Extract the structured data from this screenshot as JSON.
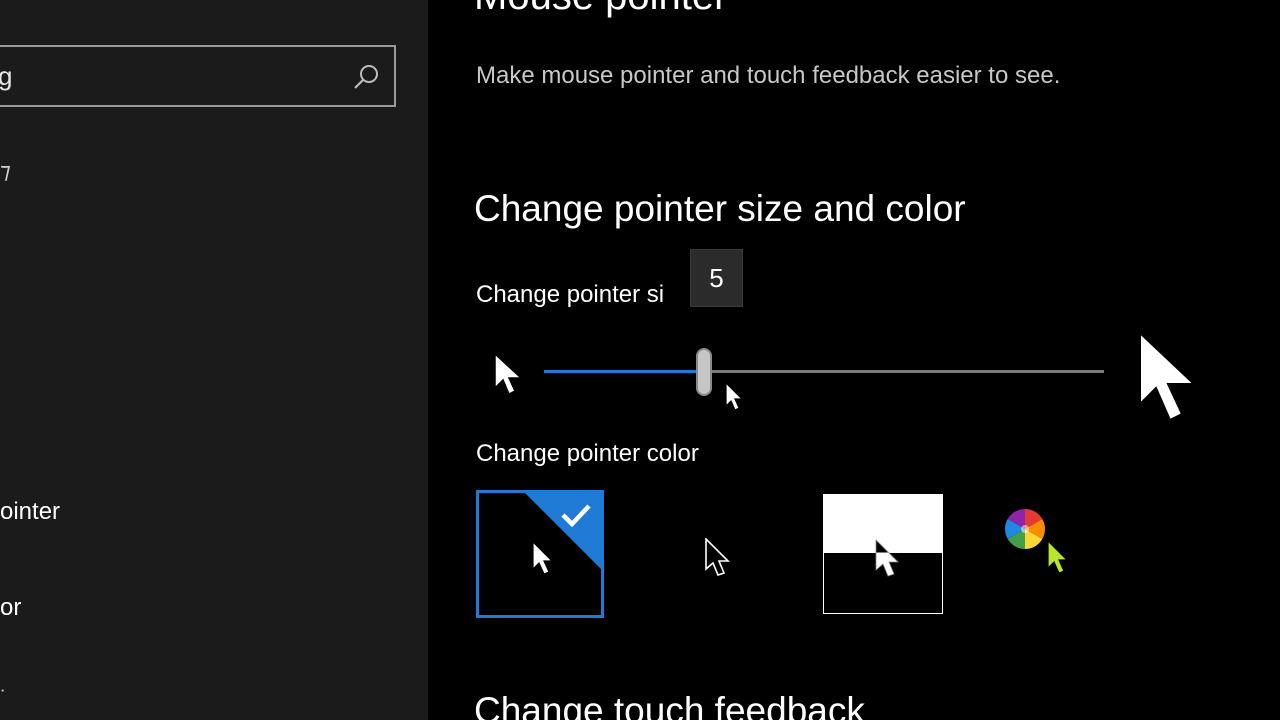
{
  "sidebar": {
    "search": {
      "value": "g"
    },
    "items": [
      {
        "label": "ointer"
      },
      {
        "label": "or"
      }
    ]
  },
  "main": {
    "page_title": "Mouse pointer",
    "description": "Make mouse pointer and touch feedback easier to see.",
    "size_section": {
      "title": "Change pointer size and color",
      "size_label": "Change pointer si",
      "tooltip_value": "5",
      "slider": {
        "value": 5,
        "min": 1,
        "max": 15
      }
    },
    "color_section": {
      "label": "Change pointer color",
      "options": [
        {
          "name": "white",
          "selected": true
        },
        {
          "name": "black",
          "selected": false
        },
        {
          "name": "inverted",
          "selected": false
        },
        {
          "name": "custom",
          "selected": false
        }
      ],
      "custom_color": "#b8e62a"
    },
    "touch_section": {
      "title": "Change touch feedback"
    }
  },
  "colors": {
    "accent": "#1f7ad6",
    "sidebar_bg": "#1b1b1b",
    "main_bg": "#000000"
  }
}
